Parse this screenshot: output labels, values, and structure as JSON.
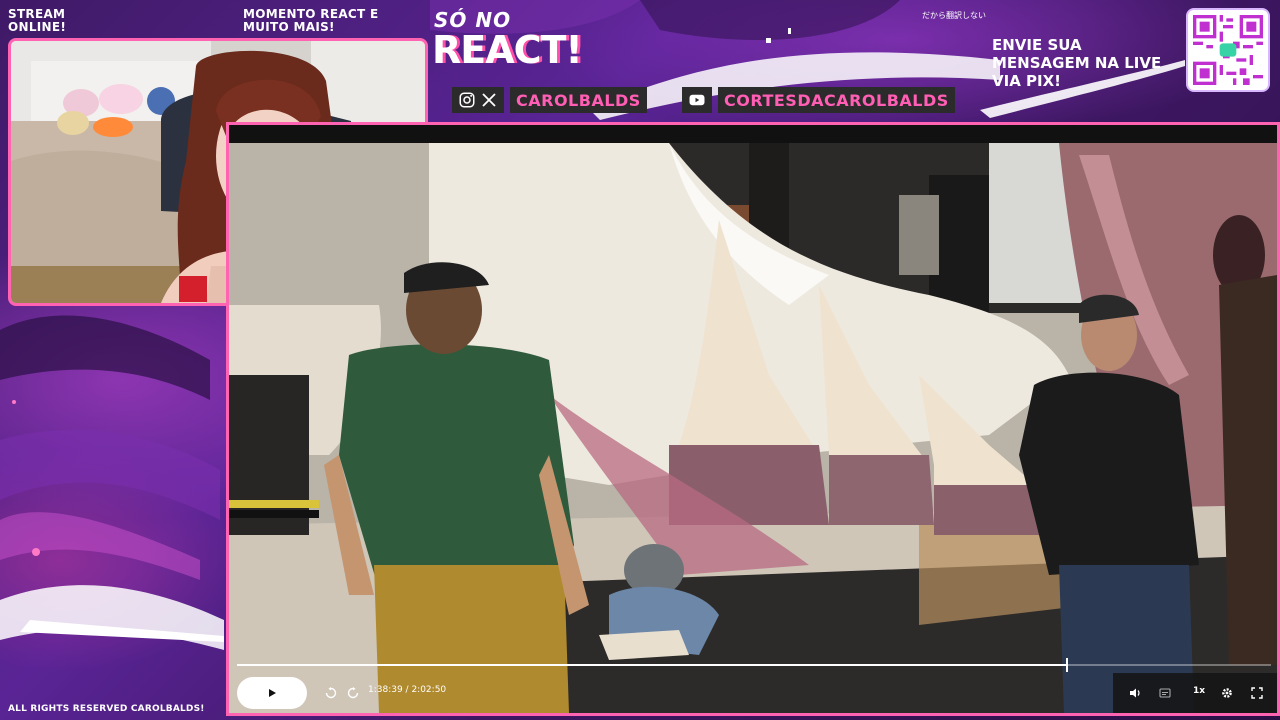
{
  "overlay": {
    "stream_online": "STREAM ONLINE!",
    "momento": "MOMENTO REACT E MUITO MAIS!",
    "logo_top": "SÓ NO",
    "logo_main": "REACT!",
    "japanese_note": "だから翻訳しない",
    "pix_message": "ENVIE SUA MENSAGEM NA LIVE VIA PIX!",
    "rights": "ALL RIGHTS RESERVED CAROLBALDS!",
    "accent_color": "#ff63b2"
  },
  "social": {
    "handle_1": "CAROLBALDS",
    "handle_1_icons": [
      "instagram-icon",
      "x-icon"
    ],
    "handle_2": "CORTESDACAROLBALDS",
    "handle_2_icons": [
      "youtube-icon"
    ]
  },
  "player": {
    "current_time": "1:38:39",
    "duration": "2:02:50",
    "time_display": "1:38:39 / 2:02:50",
    "progress": 0.803,
    "playback_rate": "1x"
  }
}
